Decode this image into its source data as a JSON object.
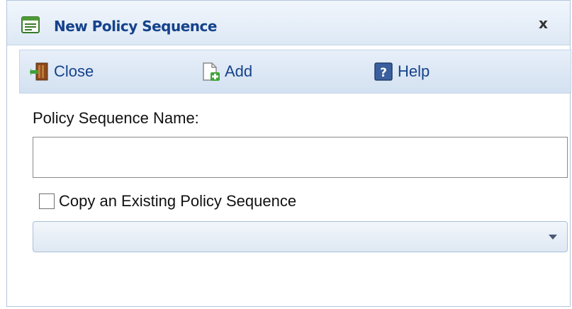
{
  "dialog": {
    "title": "New Policy Sequence",
    "close_glyph": "x",
    "title_icon": "window-form-icon"
  },
  "toolbar": {
    "close_label": "Close",
    "close_icon": "exit-door-icon",
    "add_label": "Add",
    "add_icon": "add-document-icon",
    "help_label": "Help",
    "help_icon": "help-icon"
  },
  "form": {
    "name_label": "Policy Sequence Name:",
    "name_value": "",
    "copy_checkbox_label": "Copy an Existing Policy Sequence",
    "copy_checked": false,
    "existing_sequence_selected": ""
  },
  "colors": {
    "title_text": "#15428b",
    "toolbar_text": "#15428b",
    "border": "#b3c6dc"
  }
}
